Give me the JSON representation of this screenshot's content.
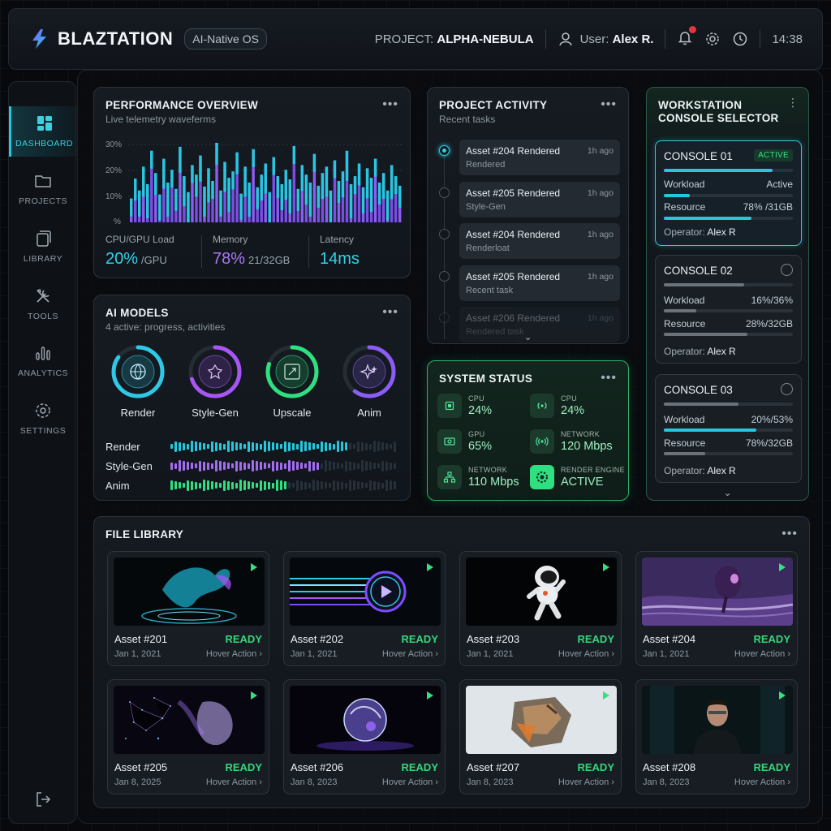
{
  "header": {
    "brand": "BLAZTATION",
    "os_pill": "AI-Native OS",
    "project_prefix": "PROJECT:",
    "project_name": "ALPHA-NEBULA",
    "user_prefix": "User:",
    "user_name": "Alex R.",
    "time": "14:38"
  },
  "sidebar": {
    "items": [
      {
        "label": "DASHBOARD",
        "icon": "dashboard-icon"
      },
      {
        "label": "PROJECTS",
        "icon": "folder-icon"
      },
      {
        "label": "LIBRARY",
        "icon": "library-icon"
      },
      {
        "label": "TOOLS",
        "icon": "tools-icon"
      },
      {
        "label": "ANALYTICS",
        "icon": "analytics-icon"
      },
      {
        "label": "SETTINGS",
        "icon": "settings-icon"
      }
    ]
  },
  "performance": {
    "title": "PERFORMANCE OVERVIEW",
    "subtitle": "Live telemetry waveferms",
    "y_ticks": [
      "30%",
      "20%",
      "10%",
      "%"
    ],
    "metrics": [
      {
        "label": "CPU/GPU Load",
        "value": "20%",
        "unit": "/GPU"
      },
      {
        "label": "Memory",
        "value": "78%",
        "unit": "21/32GB"
      },
      {
        "label": "Latency",
        "value": "14ms",
        "unit": ""
      }
    ]
  },
  "ai_models": {
    "title": "AI MODELS",
    "subtitle": "4 active: progress, activities",
    "models": [
      {
        "label": "Render",
        "progress": 0.85,
        "color": "#2ec9e6"
      },
      {
        "label": "Style-Gen",
        "progress": 0.7,
        "color": "#a855f7"
      },
      {
        "label": "Upscale",
        "progress": 0.8,
        "color": "#2ee07f"
      },
      {
        "label": "Anim",
        "progress": 0.6,
        "color": "#8b5cf6"
      }
    ],
    "activity_rows": [
      {
        "label": "Render",
        "level": 0.78,
        "color": "#25c7dc"
      },
      {
        "label": "Style-Gen",
        "level": 0.66,
        "color": "#a46cf0"
      },
      {
        "label": "Anim",
        "level": 0.52,
        "color": "#2ee07f"
      }
    ]
  },
  "project_activity": {
    "title": "PROJECT ACTIVITY",
    "subtitle": "Recent tasks",
    "items": [
      {
        "title": "Asset #204 Rendered",
        "detail": "Rendered",
        "ago": "1h ago"
      },
      {
        "title": "Asset #205 Rendered",
        "detail": "Style-Gen",
        "ago": "1h ago"
      },
      {
        "title": "Asset #204 Rendered",
        "detail": "Renderloat",
        "ago": "1h ago"
      },
      {
        "title": "Asset #205 Rendered",
        "detail": "Recent task",
        "ago": "1h ago"
      },
      {
        "title": "Asset #206 Rendered",
        "detail": "Rendered task",
        "ago": "1h ago"
      }
    ]
  },
  "system_status": {
    "title": "SYSTEM STATUS",
    "items": [
      {
        "key": "CPU",
        "value": "24%"
      },
      {
        "key": "CPU",
        "value": "24%"
      },
      {
        "key": "GPU",
        "value": "65%"
      },
      {
        "key": "NETWORK",
        "value": "120 Mbps"
      },
      {
        "key": "NETWORK",
        "value": "110 Mbps"
      },
      {
        "key": "RENDER ENGINE",
        "value": "ACTIVE"
      }
    ]
  },
  "workstation": {
    "title_line1": "WORKSTATION",
    "title_line2": "CONSOLE SELECTOR",
    "consoles": [
      {
        "name": "CONSOLE 01",
        "badge": "ACTIVE",
        "workload_label": "Workload",
        "workload_value": "Active",
        "resource_label": "Resource",
        "resource_value": "78% /31GB",
        "operator_label": "Operator:",
        "operator": "Alex R"
      },
      {
        "name": "CONSOLE 02",
        "workload_label": "Workload",
        "workload_value": "16%/36%",
        "resource_label": "Resource",
        "resource_value": "28%/32GB",
        "operator_label": "Operator:",
        "operator": "Alex R"
      },
      {
        "name": "CONSOLE 03",
        "workload_label": "Workload",
        "workload_value": "20%/53%",
        "resource_label": "Resource",
        "resource_value": "78%/32GB",
        "operator_label": "Operator:",
        "operator": "Alex R"
      }
    ]
  },
  "file_library": {
    "title": "FILE LIBRARY",
    "files": [
      {
        "name": "Asset #201",
        "status": "READY",
        "date": "Jan 1, 2021",
        "action": "Hover Action ›"
      },
      {
        "name": "Asset #202",
        "status": "READY",
        "date": "Jan 1, 2021",
        "action": "Hover Action ›"
      },
      {
        "name": "Asset #203",
        "status": "READY",
        "date": "Jan 1, 2021",
        "action": "Hover Action ›"
      },
      {
        "name": "Asset #204",
        "status": "READY",
        "date": "Jan 1, 2021",
        "action": "Hover Action ›"
      },
      {
        "name": "Asset #205",
        "status": "READY",
        "date": "Jan 8, 2025",
        "action": "Hover Action ›"
      },
      {
        "name": "Asset #206",
        "status": "READY",
        "date": "Jan 8, 2023",
        "action": "Hover Action ›"
      },
      {
        "name": "Asset #207",
        "status": "READY",
        "date": "Jan 8, 2023",
        "action": "Hover Action ›"
      },
      {
        "name": "Asset #208",
        "status": "READY",
        "date": "Jan 8, 2023",
        "action": "Hover Action ›"
      }
    ]
  },
  "colors": {
    "accent_cyan": "#25c7dc",
    "accent_purple": "#9b5cf6",
    "accent_green": "#2ee07f"
  }
}
